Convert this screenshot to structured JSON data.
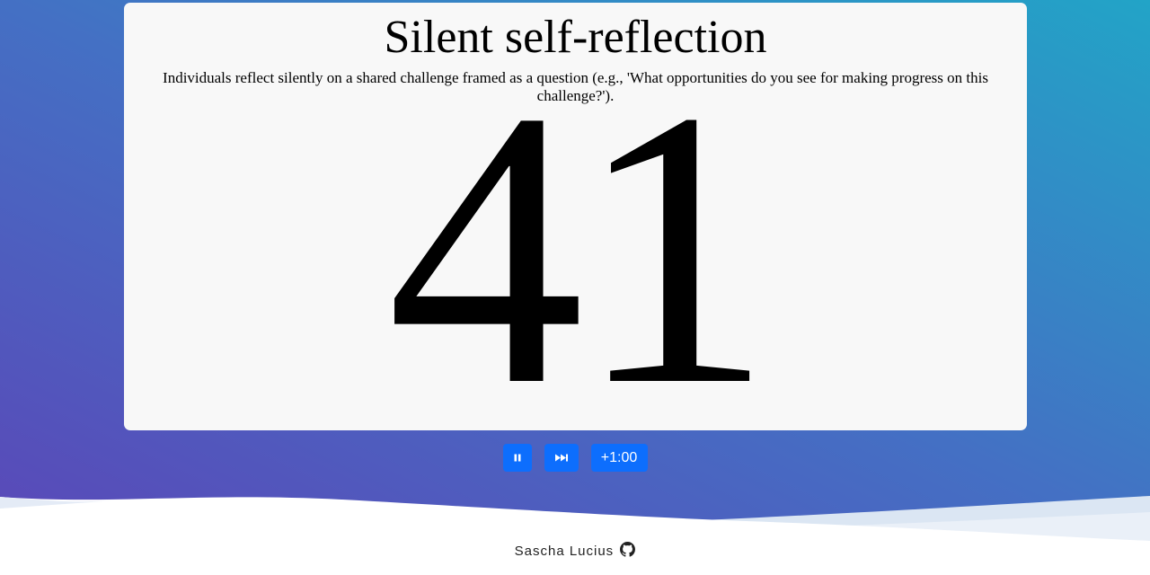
{
  "card": {
    "title": "Silent self-reflection",
    "description": "Individuals reflect silently on a shared challenge framed as a question (e.g., 'What opportunities do you see for making progress on this challenge?').",
    "countdown": "41"
  },
  "controls": {
    "pause_icon": "pause-icon",
    "next_icon": "skip-forward-icon",
    "add_time_label": "+1:00",
    "button_color": "#0d6efd"
  },
  "footer": {
    "author": "Sascha Lucius",
    "icon": "github-icon"
  },
  "colors": {
    "gradient_start": "#5a4bbd",
    "gradient_end": "#26a0c6",
    "card_bg": "#f8f8f8"
  }
}
